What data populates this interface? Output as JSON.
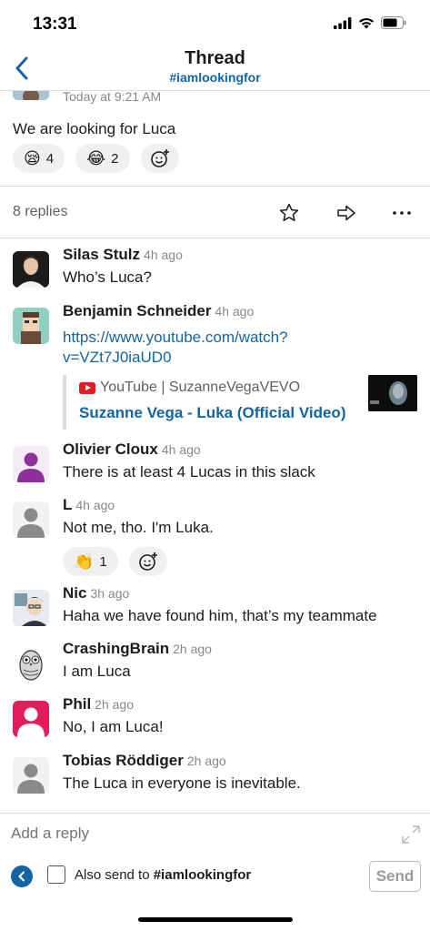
{
  "status_bar": {
    "time": "13:31"
  },
  "header": {
    "title": "Thread",
    "channel": "#iamlookingfor"
  },
  "parent_message": {
    "time": "Today at 9:21 AM",
    "text": "We are looking for Luca",
    "reactions": [
      {
        "emoji": "😪",
        "count": "4"
      },
      {
        "emoji": "😂",
        "count": "2"
      }
    ]
  },
  "replies_bar": {
    "count_label": "8 replies"
  },
  "messages": [
    {
      "name": "Silas Stulz",
      "time": "4h ago",
      "text": "Who’s Luca?"
    },
    {
      "name": "Benjamin Schneider",
      "time": "4h ago",
      "link_line1": "https://www.youtube.com/watch?",
      "link_line2": "v=VZt7J0iaUD0",
      "preview": {
        "source": "YouTube | SuzanneVegaVEVO",
        "title": "Suzanne Vega - Luka (Official Video)"
      }
    },
    {
      "name": "Olivier Cloux",
      "time": "4h ago",
      "text": "There is at least 4 Lucas in this slack"
    },
    {
      "name": "L",
      "time": "4h ago",
      "text": "Not me, tho. I'm Luka.",
      "reaction": {
        "emoji": "👏",
        "count": "1"
      }
    },
    {
      "name": "Nic",
      "time": "3h ago",
      "text": "Haha we have found him, that’s my teammate"
    },
    {
      "name": "CrashingBrain",
      "time": "2h ago",
      "text": "I am Luca"
    },
    {
      "name": "Phil",
      "time": "2h ago",
      "text": "No, I am Luca!"
    },
    {
      "name": "Tobias Röddiger",
      "time": "2h ago",
      "text": "The Luca in everyone is inevitable."
    }
  ],
  "composer": {
    "placeholder": "Add a reply",
    "also_send_prefix": "Also send to ",
    "also_send_channel": "#iamlookingfor",
    "send_label": "Send"
  },
  "colors": {
    "link": "#1264a3",
    "purple_avatar": "#8e2f9c",
    "pink_avatar": "#e01e5a"
  }
}
